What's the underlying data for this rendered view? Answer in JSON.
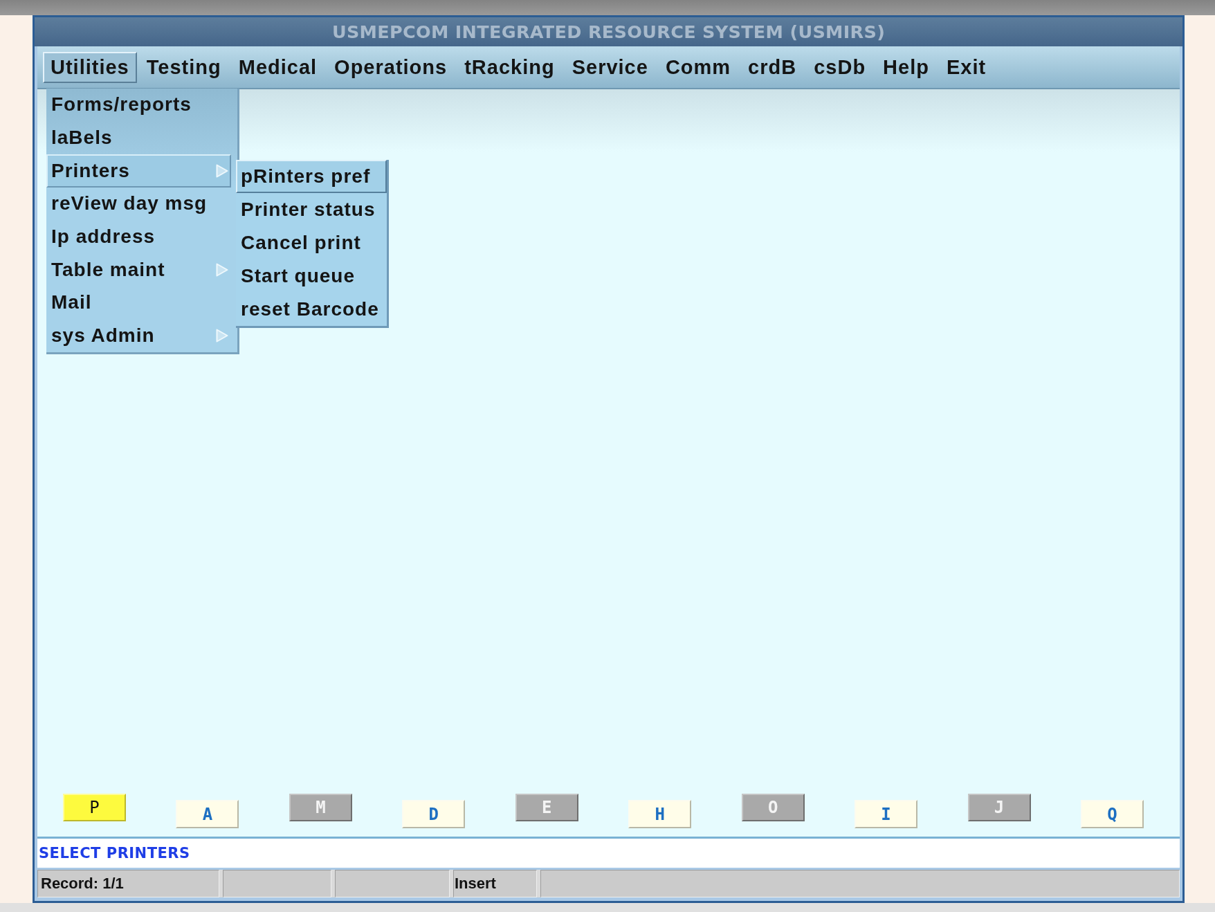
{
  "window": {
    "title": "USMEPCOM INTEGRATED RESOURCE SYSTEM (USMIRS)"
  },
  "menu_bar": [
    {
      "label": "Utilities",
      "selected": true,
      "menu_items": [
        {
          "label": "Forms/reports",
          "selected": false,
          "has_submenu": false
        },
        {
          "label": "laBels",
          "selected": false,
          "has_submenu": false
        },
        {
          "label": "Printers",
          "selected": true,
          "has_submenu": true,
          "submenu": [
            {
              "label": "pRinters pref",
              "selected": true
            },
            {
              "label": "Printer status",
              "selected": false
            },
            {
              "label": "Cancel print",
              "selected": false
            },
            {
              "label": "Start queue",
              "selected": false
            },
            {
              "label": "reset Barcode",
              "selected": false
            }
          ]
        },
        {
          "label": "reView day msg",
          "selected": false,
          "has_submenu": false
        },
        {
          "label": "Ip address",
          "selected": false,
          "has_submenu": false
        },
        {
          "label": "Table maint",
          "selected": false,
          "has_submenu": true
        },
        {
          "label": "Mail",
          "selected": false,
          "has_submenu": false
        },
        {
          "label": "sys Admin",
          "selected": false,
          "has_submenu": true
        }
      ]
    },
    {
      "label": "Testing",
      "selected": false
    },
    {
      "label": "Medical",
      "selected": false
    },
    {
      "label": "Operations",
      "selected": false
    },
    {
      "label": "tRacking",
      "selected": false
    },
    {
      "label": "Service",
      "selected": false
    },
    {
      "label": "Comm",
      "selected": false
    },
    {
      "label": "crdB",
      "selected": false
    },
    {
      "label": "csDb",
      "selected": false
    },
    {
      "label": "Help",
      "selected": false
    },
    {
      "label": "Exit",
      "selected": false
    }
  ],
  "shortcut_buttons": [
    {
      "label": "P",
      "selected": true,
      "disabled": false
    },
    {
      "label": "A",
      "selected": false,
      "disabled": false
    },
    {
      "label": "M",
      "selected": false,
      "disabled": true
    },
    {
      "label": "D",
      "selected": false,
      "disabled": false
    },
    {
      "label": "E",
      "selected": false,
      "disabled": true
    },
    {
      "label": "H",
      "selected": false,
      "disabled": false
    },
    {
      "label": "O",
      "selected": false,
      "disabled": true
    },
    {
      "label": "I",
      "selected": false,
      "disabled": false
    },
    {
      "label": "J",
      "selected": false,
      "disabled": true
    },
    {
      "label": "Q",
      "selected": false,
      "disabled": false
    }
  ],
  "message": "SELECT PRINTERS",
  "status_bar": {
    "record": "Record: 1/1",
    "mode": "Insert"
  }
}
